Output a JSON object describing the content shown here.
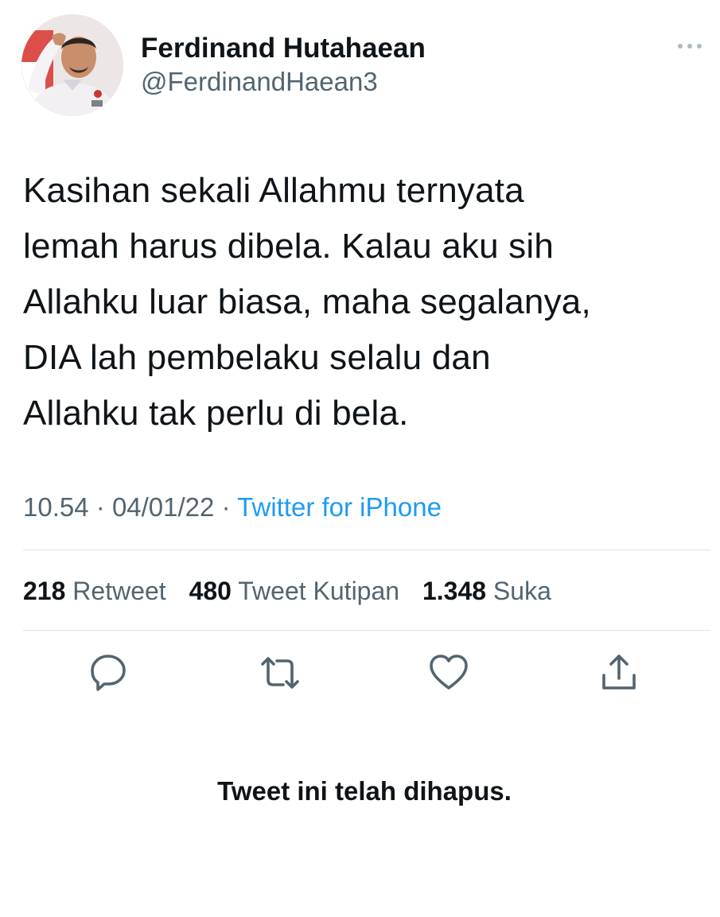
{
  "author": {
    "display_name": "Ferdinand Hutahaean",
    "handle": "@FerdinandHaean3"
  },
  "tweet": {
    "lines": [
      "Kasihan sekali Allahmu ternyata",
      "lemah harus dibela. Kalau aku sih",
      "Allahku luar biasa, maha segalanya,",
      "DIA lah pembelaku selalu dan",
      "Allahku tak perlu di bela."
    ]
  },
  "meta": {
    "time": "10.54",
    "separator": "·",
    "date": "04/01/22",
    "source": "Twitter for iPhone"
  },
  "stats": {
    "retweets_count": "218",
    "retweets_label": "Retweet",
    "quotes_count": "480",
    "quotes_label": "Tweet Kutipan",
    "likes_count": "1.348",
    "likes_label": "Suka"
  },
  "icons": {
    "more": "more-horizontal-icon",
    "reply": "reply-bubble-icon",
    "retweet": "retweet-icon",
    "like": "heart-icon",
    "share": "share-upload-icon"
  },
  "colors": {
    "text": "#0f1419",
    "secondary": "#536471",
    "link": "#1d9bf0",
    "divider": "#e1e6ea"
  },
  "notice": {
    "deleted": "Tweet ini telah dihapus."
  }
}
